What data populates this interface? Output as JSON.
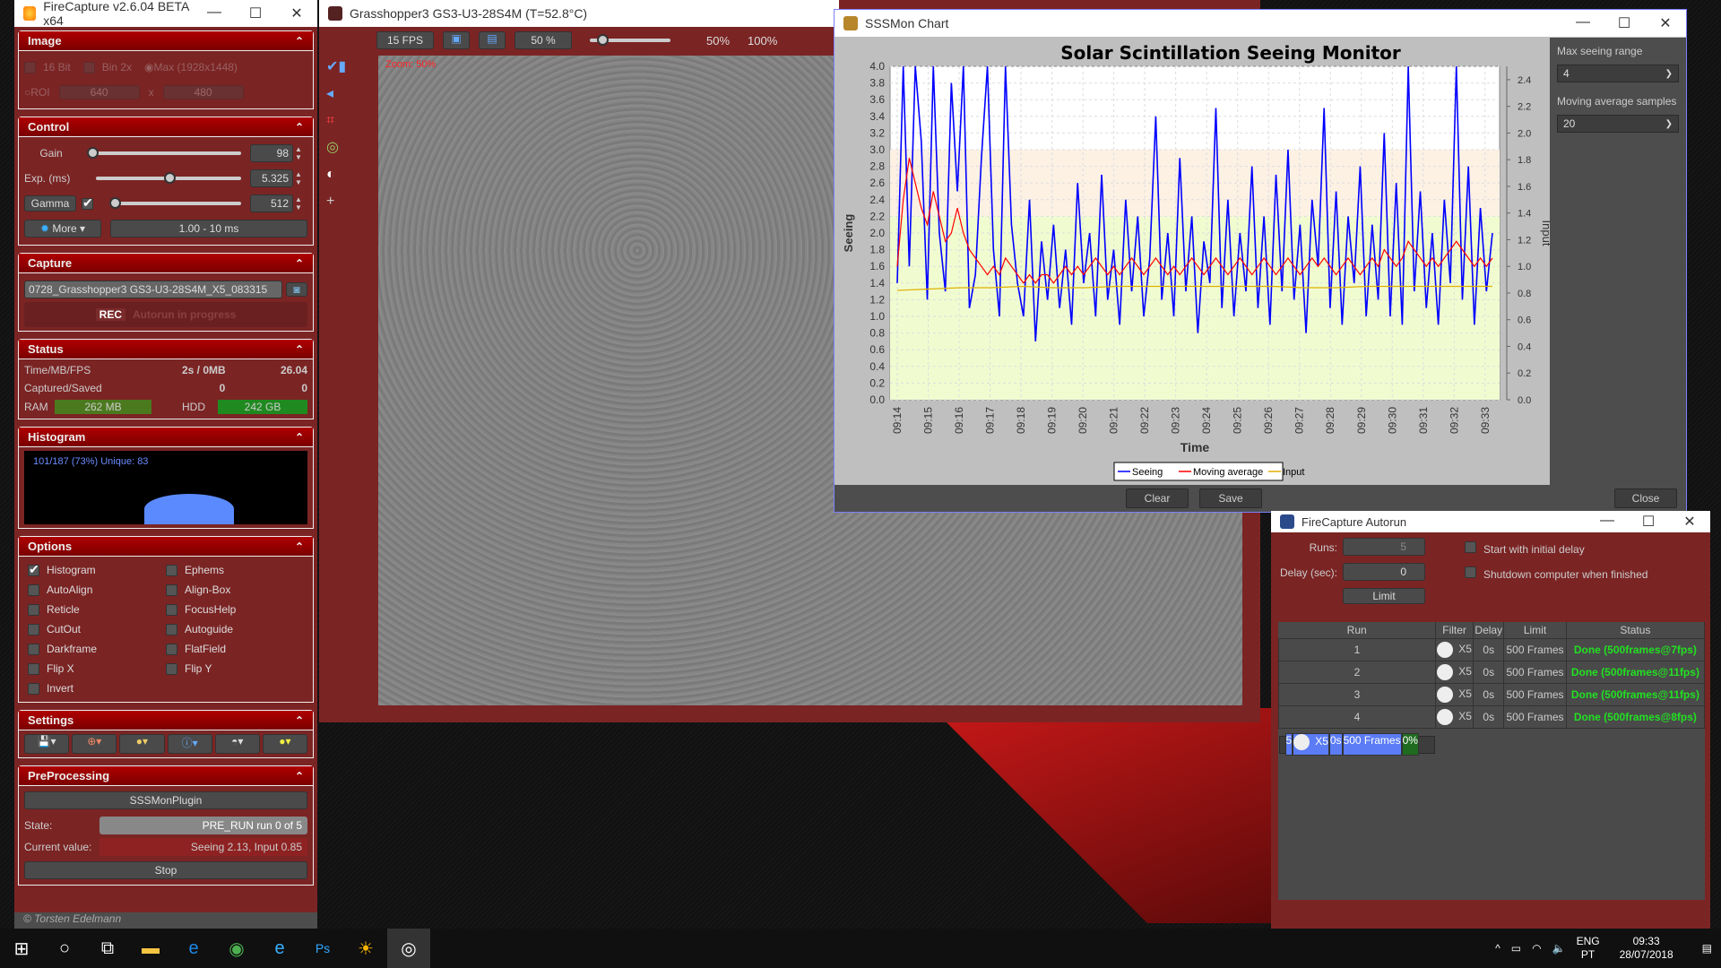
{
  "firecapture": {
    "title": "FireCapture v2.6.04 BETA x64",
    "image": {
      "header": "Image",
      "bit16": "16 Bit",
      "bin": "Bin 2x",
      "max": "Max (1928x1448)",
      "roi": "ROI",
      "roi_w": "640",
      "x": "x",
      "roi_h": "480"
    },
    "control": {
      "header": "Control",
      "gain_label": "Gain",
      "gain": "98",
      "gain_frac": 0.0,
      "exp_label": "Exp. (ms)",
      "exp": "5.325",
      "exp_frac": 0.47,
      "gamma_label": "Gamma",
      "gamma": "512",
      "gamma_frac": 0.0,
      "more": "More",
      "range": "1.00 - 10 ms"
    },
    "capture": {
      "header": "Capture",
      "filename": "0728_Grasshopper3 GS3-U3-28S4M_X5_083315",
      "rec": "REC",
      "rec_status": "Autorun in progress"
    },
    "status": {
      "header": "Status",
      "r1_label": "Time/MB/FPS",
      "r1_val": "2s / 0MB",
      "r1_fps": "26.04",
      "r2_label": "Captured/Saved",
      "r2_a": "0",
      "r2_b": "0",
      "ram_label": "RAM",
      "ram": "262 MB",
      "hdd_label": "HDD",
      "hdd": "242 GB"
    },
    "histogram": {
      "header": "Histogram",
      "info": "101/187 (73%)  Unique: 83"
    },
    "options": {
      "header": "Options",
      "items": [
        {
          "label": "Histogram",
          "checked": true
        },
        {
          "label": "Ephems",
          "checked": false
        },
        {
          "label": "AutoAlign",
          "checked": false
        },
        {
          "label": "Align-Box",
          "checked": false
        },
        {
          "label": "Reticle",
          "checked": false
        },
        {
          "label": "FocusHelp",
          "checked": false
        },
        {
          "label": "CutOut",
          "checked": false
        },
        {
          "label": "Autoguide",
          "checked": false
        },
        {
          "label": "Darkframe",
          "checked": false
        },
        {
          "label": "FlatField",
          "checked": false
        },
        {
          "label": "Flip X",
          "checked": false
        },
        {
          "label": "Flip Y",
          "checked": false
        },
        {
          "label": "Invert",
          "checked": false
        }
      ]
    },
    "settings": {
      "header": "Settings",
      "icons": [
        "save-settings-icon",
        "planet-crosshair-icon",
        "color-wheel-icon",
        "info-document-icon",
        "gauge-icon",
        "sun-planet-icon"
      ]
    },
    "preprocessing": {
      "header": "PreProcessing",
      "plugin": "SSSMonPlugin",
      "state_label": "State:",
      "state": "PRE_RUN run 0 of 5",
      "current_label": "Current value:",
      "current": "Seeing 2.13, Input 0.85",
      "stop": "Stop"
    },
    "footer": "© Torsten Edelmann"
  },
  "camera": {
    "title": "Grasshopper3 GS3-U3-28S4M (T=52.8°C)",
    "fps": "15 FPS",
    "zoom": "50 %",
    "zoom50": "50%",
    "zoom100": "100%",
    "zoom_overlay": "Zoom: 50%"
  },
  "sssmon": {
    "title": "SSSMon Chart",
    "max_range_label": "Max seeing range",
    "max_range": "4",
    "mavg_label": "Moving average samples",
    "mavg": "20",
    "clear": "Clear",
    "save": "Save",
    "close": "Close"
  },
  "chart_data": {
    "type": "line",
    "title": "Solar Scintillation Seeing Monitor",
    "xlabel": "Time",
    "ylabel": "Seeing",
    "y2label": "Input",
    "ylim": [
      0,
      4.0
    ],
    "y2lim": [
      0,
      2.5
    ],
    "yticks": [
      "0.0",
      "0.2",
      "0.4",
      "0.6",
      "0.8",
      "1.0",
      "1.2",
      "1.4",
      "1.6",
      "1.8",
      "2.0",
      "2.2",
      "2.4",
      "2.6",
      "2.8",
      "3.0",
      "3.2",
      "3.4",
      "3.6",
      "3.8",
      "4.0"
    ],
    "y2ticks": [
      "0.0",
      "0.2",
      "0.4",
      "0.6",
      "0.8",
      "1.0",
      "1.2",
      "1.4",
      "1.6",
      "1.8",
      "2.0",
      "2.2",
      "2.4"
    ],
    "categories": [
      "09:14",
      "09:15",
      "09:16",
      "09:17",
      "09:18",
      "09:19",
      "09:20",
      "09:21",
      "09:22",
      "09:23",
      "09:24",
      "09:25",
      "09:26",
      "09:27",
      "09:28",
      "09:29",
      "09:30",
      "09:31",
      "09:32",
      "09:33"
    ],
    "bands": [
      {
        "from": 0,
        "to": 2.2,
        "color": "#f0fcd0"
      },
      {
        "from": 2.2,
        "to": 3.0,
        "color": "#fdf1e4"
      }
    ],
    "legend": [
      "Seeing",
      "Moving average",
      "Input"
    ],
    "legend_position": "bottom",
    "series": [
      {
        "name": "Seeing",
        "color": "#0000ff",
        "values": [
          1.4,
          4.0,
          1.6,
          4.0,
          3.1,
          1.2,
          4.0,
          2.0,
          1.3,
          3.8,
          2.5,
          4.0,
          1.1,
          1.5,
          2.9,
          4.0,
          1.8,
          1.0,
          4.0,
          2.1,
          1.4,
          1.0,
          2.4,
          0.7,
          1.9,
          1.2,
          2.1,
          1.1,
          1.8,
          0.9,
          2.6,
          1.4,
          2.0,
          1.0,
          2.7,
          1.2,
          1.8,
          0.9,
          2.4,
          1.3,
          2.2,
          1.0,
          1.7,
          3.4,
          1.2,
          2.0,
          1.0,
          2.9,
          1.3,
          2.2,
          0.8,
          1.9,
          1.4,
          3.5,
          1.1,
          2.4,
          1.0,
          2.0,
          1.3,
          2.8,
          1.1,
          2.2,
          0.9,
          2.7,
          1.3,
          3.0,
          1.2,
          2.1,
          0.8,
          2.4,
          1.6,
          3.5,
          1.1,
          2.5,
          0.9,
          2.2,
          1.4,
          2.8,
          1.0,
          2.1,
          1.2,
          3.2,
          1.0,
          2.6,
          0.9,
          4.0,
          1.3,
          2.5,
          1.1,
          2.0,
          0.9,
          2.4,
          1.4,
          4.0,
          1.2,
          2.8,
          0.9,
          2.3,
          1.3,
          2.0
        ]
      },
      {
        "name": "Moving average",
        "color": "#ff0000",
        "values": [
          1.6,
          2.4,
          2.9,
          2.6,
          2.3,
          2.1,
          2.5,
          2.2,
          1.9,
          2.0,
          2.3,
          2.0,
          1.8,
          1.7,
          1.6,
          1.5,
          1.6,
          1.5,
          1.7,
          1.6,
          1.5,
          1.4,
          1.5,
          1.4,
          1.5,
          1.5,
          1.4,
          1.5,
          1.6,
          1.5,
          1.6,
          1.5,
          1.6,
          1.7,
          1.6,
          1.5,
          1.6,
          1.5,
          1.6,
          1.7,
          1.6,
          1.5,
          1.6,
          1.7,
          1.6,
          1.5,
          1.6,
          1.5,
          1.6,
          1.7,
          1.6,
          1.5,
          1.6,
          1.7,
          1.6,
          1.5,
          1.6,
          1.7,
          1.6,
          1.5,
          1.6,
          1.7,
          1.6,
          1.5,
          1.6,
          1.7,
          1.6,
          1.5,
          1.6,
          1.7,
          1.6,
          1.7,
          1.6,
          1.5,
          1.6,
          1.7,
          1.6,
          1.5,
          1.6,
          1.7,
          1.6,
          1.8,
          1.7,
          1.6,
          1.7,
          1.9,
          1.8,
          1.7,
          1.6,
          1.7,
          1.6,
          1.7,
          1.8,
          1.9,
          1.8,
          1.7,
          1.6,
          1.7,
          1.6,
          1.7
        ]
      },
      {
        "name": "Input",
        "color": "#e0b000",
        "axis": "y2",
        "values": [
          0.82,
          0.83,
          0.84,
          0.84,
          0.85,
          0.84,
          0.84,
          0.85,
          0.85,
          0.85,
          0.85,
          0.85,
          0.85,
          0.84,
          0.84,
          0.85,
          0.85,
          0.85,
          0.85,
          0.85
        ]
      }
    ]
  },
  "autorun": {
    "title": "FireCapture Autorun",
    "runs_label": "Runs:",
    "runs": "5",
    "delay_label": "Delay (sec):",
    "delay": "0",
    "limit": "Limit",
    "cb1": "Start with initial delay",
    "cb2": "Shutdown computer when finished",
    "columns": [
      "Run",
      "Filter",
      "Delay",
      "Limit",
      "Status"
    ],
    "rows": [
      {
        "run": "1",
        "filter": "X5",
        "delay": "0s",
        "limit": "500 Frames",
        "status": "Done  (500frames@7fps)"
      },
      {
        "run": "2",
        "filter": "X5",
        "delay": "0s",
        "limit": "500 Frames",
        "status": "Done  (500frames@11fps)"
      },
      {
        "run": "3",
        "filter": "X5",
        "delay": "0s",
        "limit": "500 Frames",
        "status": "Done  (500frames@11fps)"
      },
      {
        "run": "4",
        "filter": "X5",
        "delay": "0s",
        "limit": "500 Frames",
        "status": "Done  (500frames@8fps)"
      },
      {
        "run": "5",
        "filter": "X5",
        "delay": "0s",
        "limit": "500 Frames",
        "status": "0%",
        "progress": 0
      }
    ]
  },
  "taskbar": {
    "lang1": "ENG",
    "lang2": "PT",
    "time": "09:33",
    "date": "28/07/2018"
  }
}
